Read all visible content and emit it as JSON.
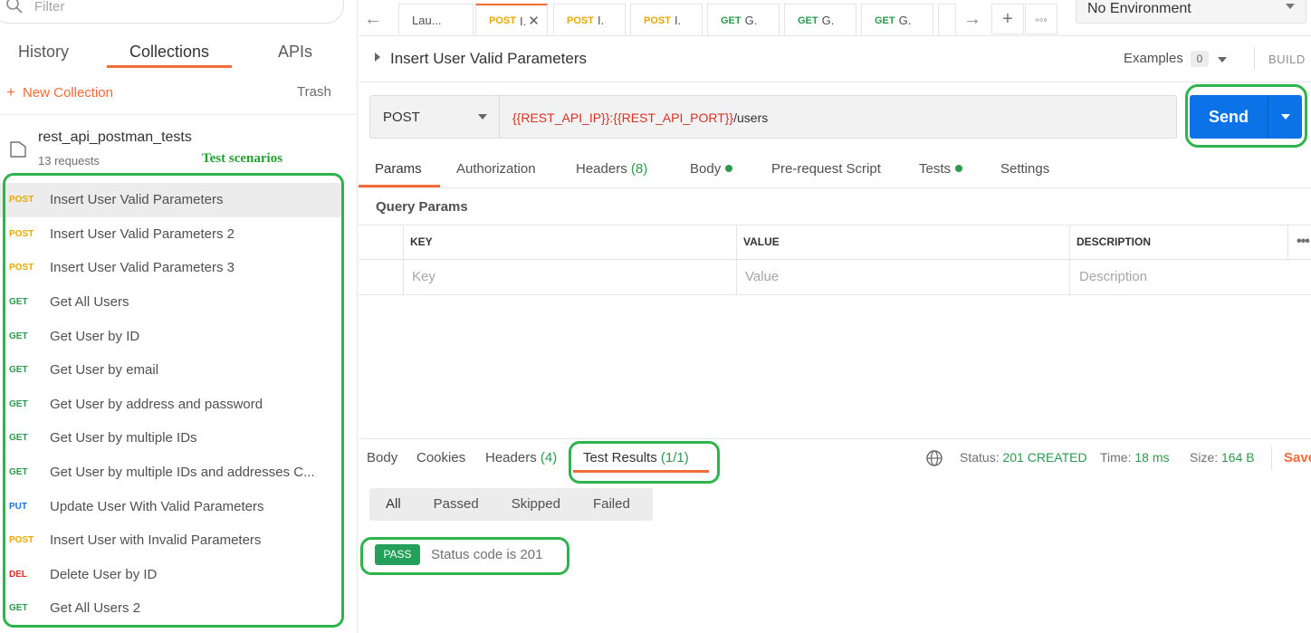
{
  "sidebar": {
    "filter_placeholder": "Filter",
    "tabs": [
      "History",
      "Collections",
      "APIs"
    ],
    "new_collection": "New Collection",
    "trash": "Trash",
    "collection": {
      "name": "rest_api_postman_tests",
      "count": "13 requests"
    },
    "annotation": "Test scenarios",
    "requests": [
      {
        "method": "POST",
        "name": "Insert User Valid Parameters"
      },
      {
        "method": "POST",
        "name": "Insert User Valid Parameters 2"
      },
      {
        "method": "POST",
        "name": "Insert User Valid Parameters 3"
      },
      {
        "method": "GET",
        "name": "Get All Users"
      },
      {
        "method": "GET",
        "name": "Get User by ID"
      },
      {
        "method": "GET",
        "name": "Get User by email"
      },
      {
        "method": "GET",
        "name": "Get User by address and password"
      },
      {
        "method": "GET",
        "name": "Get User by multiple IDs"
      },
      {
        "method": "GET",
        "name": "Get User by multiple IDs and addresses C..."
      },
      {
        "method": "PUT",
        "name": "Update User With Valid Parameters"
      },
      {
        "method": "POST",
        "name": "Insert User with Invalid Parameters"
      },
      {
        "method": "DEL",
        "name": "Delete User by ID"
      },
      {
        "method": "GET",
        "name": "Get All Users 2"
      }
    ]
  },
  "tabbar": {
    "tabs": [
      {
        "method": "",
        "label": "Lau..."
      },
      {
        "method": "POST",
        "label": "I."
      },
      {
        "method": "POST",
        "label": "I."
      },
      {
        "method": "POST",
        "label": "I."
      },
      {
        "method": "GET",
        "label": "G."
      },
      {
        "method": "GET",
        "label": "G."
      },
      {
        "method": "GET",
        "label": "G."
      }
    ],
    "environment": "No Environment"
  },
  "request": {
    "title": "Insert User Valid Parameters",
    "examples_label": "Examples",
    "examples_count": "0",
    "build_label": "BUILD",
    "method": "POST",
    "url_var1": "{{REST_API_IP}}",
    "url_colon": ":",
    "url_var2": "{{REST_API_PORT}}",
    "url_path": "/users",
    "send_label": "Send",
    "tabs": {
      "params": "Params",
      "authorization": "Authorization",
      "headers": "Headers",
      "headers_count": "(8)",
      "body": "Body",
      "prerequest": "Pre-request Script",
      "tests": "Tests",
      "settings": "Settings"
    },
    "query_params_title": "Query Params",
    "columns": [
      "KEY",
      "VALUE",
      "DESCRIPTION"
    ],
    "placeholders": {
      "key": "Key",
      "value": "Value",
      "description": "Description"
    }
  },
  "response": {
    "tabs": {
      "body": "Body",
      "cookies": "Cookies",
      "headers": "Headers",
      "headers_count": "(4)",
      "test_results": "Test Results",
      "test_results_count": "(1/1)"
    },
    "status_label": "Status:",
    "status_value": "201 CREATED",
    "time_label": "Time:",
    "time_value": "18 ms",
    "size_label": "Size:",
    "size_value": "164 B",
    "save_label": "Save",
    "filters": [
      "All",
      "Passed",
      "Skipped",
      "Failed"
    ],
    "result": {
      "badge": "PASS",
      "text": "Status code is 201"
    }
  },
  "colors": {
    "accent": "#f26b3a",
    "send": "#0b72e8",
    "post": "#e8a800",
    "get": "#2b9a4c",
    "put": "#1f74d4",
    "delete": "#d93025",
    "annotation": "#2fb34d"
  }
}
